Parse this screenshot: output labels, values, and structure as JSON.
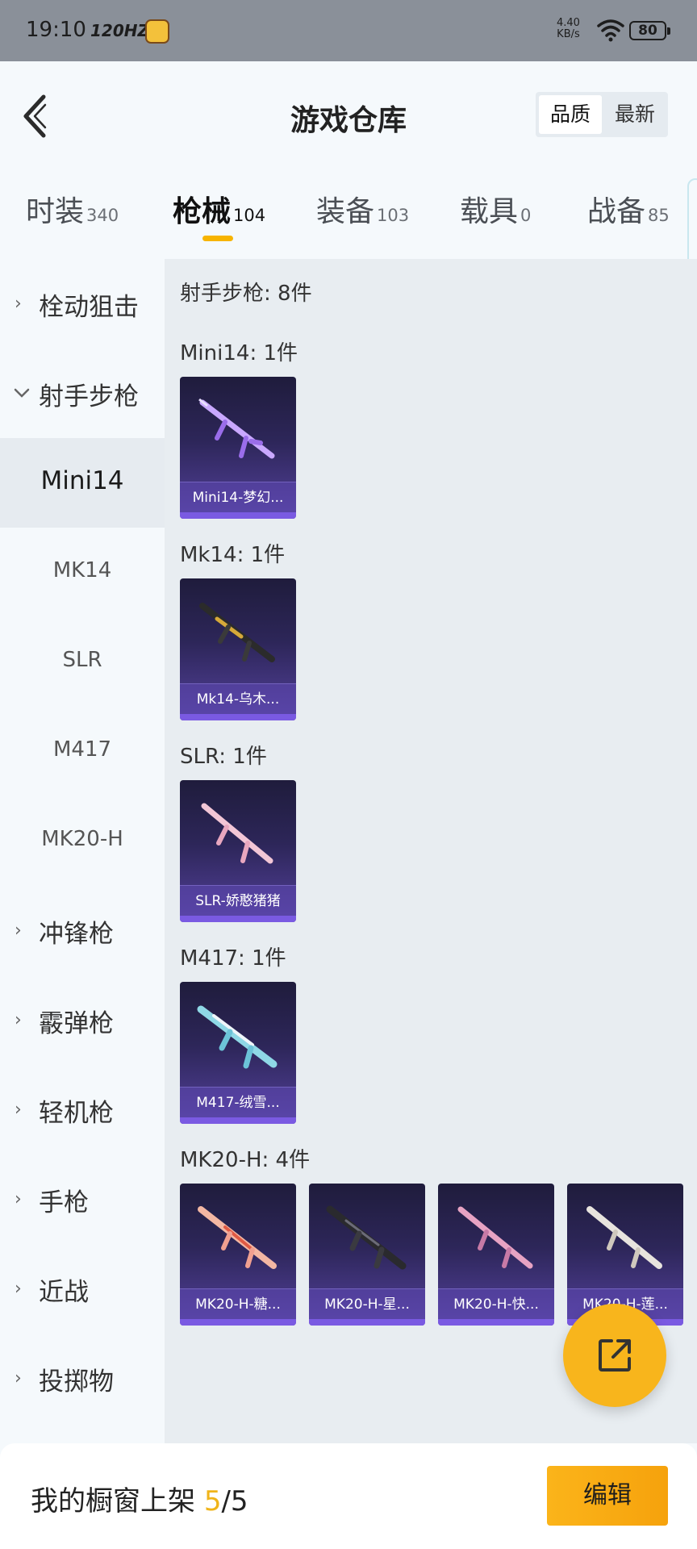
{
  "status_bar": {
    "time": "19:10",
    "refresh": "120HZ",
    "net_speed_value": "4.40",
    "net_speed_unit": "KB/s",
    "battery": "80"
  },
  "header": {
    "title": "游戏仓库",
    "sort_options": [
      "品质",
      "最新"
    ],
    "active_sort": "品质"
  },
  "tabs": [
    {
      "label": "时装",
      "count": "340"
    },
    {
      "label": "枪械",
      "count": "104"
    },
    {
      "label": "装备",
      "count": "103"
    },
    {
      "label": "载具",
      "count": "0"
    },
    {
      "label": "战备",
      "count": "85"
    }
  ],
  "active_tab": "枪械",
  "sidebar": {
    "items": [
      {
        "label": "栓动狙击",
        "type": "category",
        "expanded": false
      },
      {
        "label": "射手步枪",
        "type": "category",
        "expanded": true
      },
      {
        "label": "Mini14",
        "type": "sub",
        "active": true
      },
      {
        "label": "MK14",
        "type": "sub"
      },
      {
        "label": "SLR",
        "type": "sub"
      },
      {
        "label": "M417",
        "type": "sub"
      },
      {
        "label": "MK20-H",
        "type": "sub"
      },
      {
        "label": "冲锋枪",
        "type": "category",
        "expanded": false
      },
      {
        "label": "霰弹枪",
        "type": "category",
        "expanded": false
      },
      {
        "label": "轻机枪",
        "type": "category",
        "expanded": false
      },
      {
        "label": "手枪",
        "type": "category",
        "expanded": false
      },
      {
        "label": "近战",
        "type": "category",
        "expanded": false
      },
      {
        "label": "投掷物",
        "type": "category",
        "expanded": false
      }
    ]
  },
  "content": {
    "summary": "射手步枪: 8件",
    "groups": [
      {
        "title": "Mini14: 1件",
        "items": [
          {
            "label": "Mini14-梦幻..."
          }
        ]
      },
      {
        "title": "Mk14: 1件",
        "items": [
          {
            "label": "Mk14-乌木..."
          }
        ]
      },
      {
        "title": "SLR: 1件",
        "items": [
          {
            "label": "SLR-娇憨猪猪"
          }
        ]
      },
      {
        "title": "M417: 1件",
        "items": [
          {
            "label": "M417-绒雪..."
          }
        ]
      },
      {
        "title": "MK20-H: 4件",
        "items": [
          {
            "label": "MK20-H-糖..."
          },
          {
            "label": "MK20-H-星..."
          },
          {
            "label": "MK20-H-快..."
          },
          {
            "label": "MK20-H-莲..."
          }
        ]
      }
    ]
  },
  "bottom_bar": {
    "label": "我的橱窗上架",
    "count_current": "5",
    "count_separator": "/",
    "count_total": "5",
    "edit_button": "编辑"
  },
  "colors": {
    "accent": "#f8b51c",
    "card_purple": "#54419c",
    "underline": "#f7b400"
  },
  "icons": {
    "back": "chevron-left-icon",
    "share": "share-external-icon",
    "wifi": "wifi-icon",
    "battery": "battery-icon"
  }
}
